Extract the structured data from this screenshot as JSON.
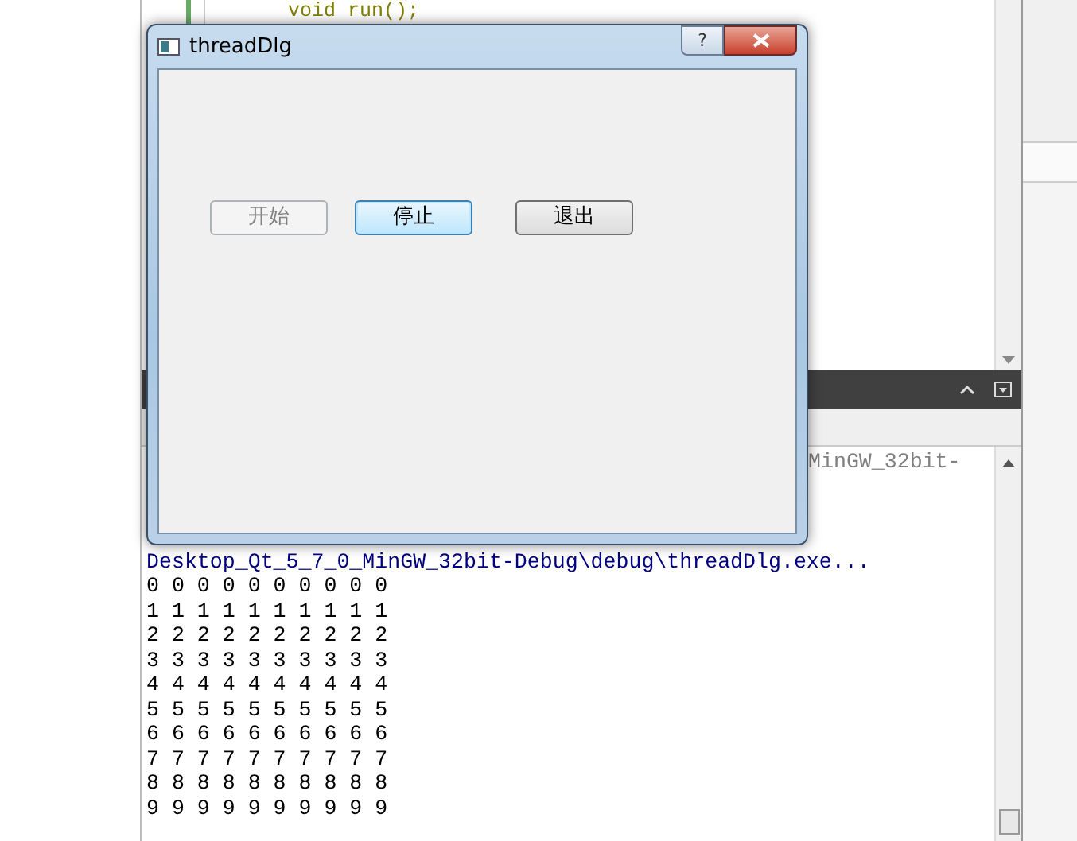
{
  "editor": {
    "code_line": "void run();"
  },
  "output": {
    "partial_line": "MinGW_32bit-",
    "path_line": "Desktop_Qt_5_7_0_MinGW_32bit-Debug\\debug\\threadDlg.exe...",
    "lines": [
      "0 0 0 0 0 0 0 0 0 0",
      "1 1 1 1 1 1 1 1 1 1",
      "2 2 2 2 2 2 2 2 2 2",
      "3 3 3 3 3 3 3 3 3 3",
      "4 4 4 4 4 4 4 4 4 4",
      "5 5 5 5 5 5 5 5 5 5",
      "6 6 6 6 6 6 6 6 6 6",
      "7 7 7 7 7 7 7 7 7 7",
      "8 8 8 8 8 8 8 8 8 8",
      "9 9 9 9 9 9 9 9 9 9"
    ]
  },
  "dialog": {
    "title": "threadDlg",
    "help": "?",
    "buttons": [
      {
        "label": "开始",
        "disabled": true,
        "focused": false
      },
      {
        "label": "停止",
        "disabled": false,
        "focused": true
      },
      {
        "label": "退出",
        "disabled": false,
        "focused": false
      }
    ]
  }
}
